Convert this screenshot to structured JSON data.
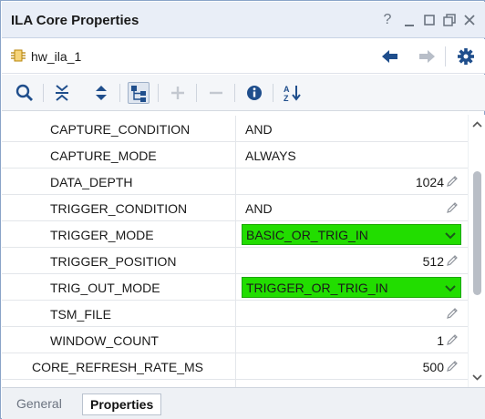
{
  "window": {
    "title": "ILA Core Properties",
    "controls": {
      "help": "?",
      "minimize": "_",
      "restore": "◻",
      "float": "⧉",
      "close": "✕"
    }
  },
  "object": {
    "name": "hw_ila_1"
  },
  "toolbar": {
    "buttons": [
      "search",
      "collapse-all",
      "expand-all",
      "hierarchy",
      "add",
      "remove",
      "info",
      "sort-az"
    ],
    "sort_label": "A↓Z"
  },
  "properties": [
    {
      "name": "CAPTURE_CONDITION",
      "value": "AND",
      "editor": "text",
      "indent": 1
    },
    {
      "name": "CAPTURE_MODE",
      "value": "ALWAYS",
      "editor": "text",
      "indent": 1
    },
    {
      "name": "DATA_DEPTH",
      "value": "1024",
      "editor": "number",
      "indent": 1
    },
    {
      "name": "TRIGGER_CONDITION",
      "value": "AND",
      "editor": "text-edit",
      "indent": 1
    },
    {
      "name": "TRIGGER_MODE",
      "value": "BASIC_OR_TRIG_IN",
      "editor": "dropdown",
      "indent": 1
    },
    {
      "name": "TRIGGER_POSITION",
      "value": "512",
      "editor": "number",
      "indent": 1
    },
    {
      "name": "TRIG_OUT_MODE",
      "value": "TRIGGER_OR_TRIG_IN",
      "editor": "dropdown",
      "indent": 1
    },
    {
      "name": "TSM_FILE",
      "value": "",
      "editor": "text-edit",
      "indent": 1
    },
    {
      "name": "WINDOW_COUNT",
      "value": "1",
      "editor": "number",
      "indent": 1
    },
    {
      "name": "CORE_REFRESH_RATE_MS",
      "value": "500",
      "editor": "number",
      "indent": 0
    }
  ],
  "tabs": {
    "general": "General",
    "properties": "Properties",
    "active": "properties"
  },
  "colors": {
    "dropdown_highlight": "#22dd00",
    "titlebar": "#e9eef7",
    "nav_back": "#1f4e8c",
    "gear": "#1f4e8c"
  }
}
